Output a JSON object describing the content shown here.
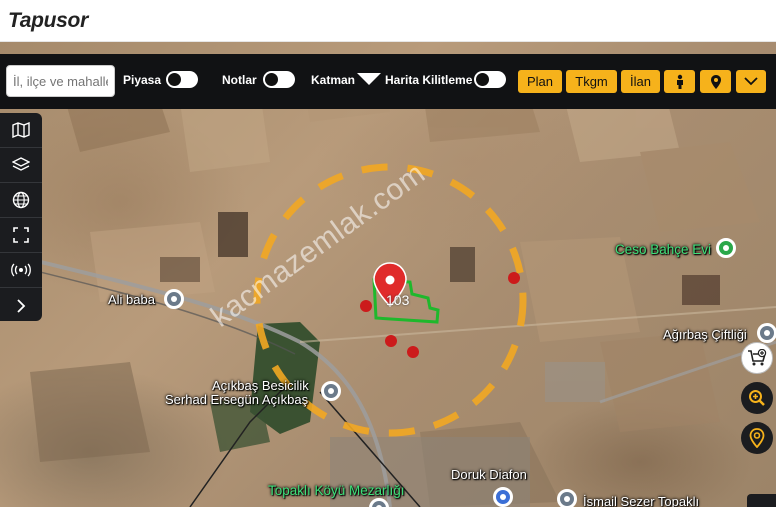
{
  "header": {
    "brand": "Tapusor"
  },
  "toolbar": {
    "search_placeholder": "İl, ilçe ve mahalle",
    "toggles": [
      {
        "label": "Piyasa",
        "on": false
      },
      {
        "label": "Notlar",
        "on": false
      },
      {
        "label": "Harita Kilitleme",
        "on": false
      }
    ],
    "layer_label": "Katman",
    "buttons": {
      "plan": "Plan",
      "tkgm": "Tkgm",
      "ilan": "İlan"
    },
    "accent_color": "#f6b21b"
  },
  "sidebar": {
    "items": [
      "map-icon",
      "layers-icon",
      "globe-icon",
      "fullscreen-icon",
      "broadcast-icon",
      "chevron-right-icon"
    ]
  },
  "map": {
    "parcel_number": "103",
    "parcel_color": "#1fb82c",
    "radius_circle_color": "#f2a722",
    "watermark": "kacmazemlak.com",
    "places": [
      {
        "name": "Ali baba"
      },
      {
        "name": "Ceso Bahçe Evi"
      },
      {
        "name": "Ağırbaş Çiftliği"
      },
      {
        "name": "Açıkbaş Besicilik"
      },
      {
        "name": "Serhad Ersegün Açıkbaş"
      },
      {
        "name": "Topaklı Köyü Mezarlığı"
      },
      {
        "name": "Doruk Diafon"
      },
      {
        "name": "İsmail Sezer Topaklı"
      }
    ]
  }
}
